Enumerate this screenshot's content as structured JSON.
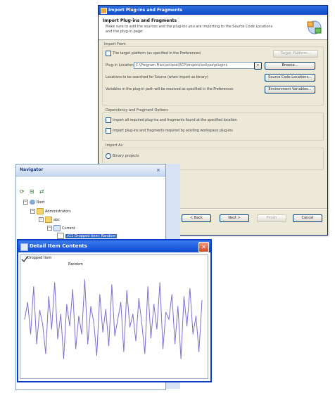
{
  "wizard": {
    "title": "Import Plug-ins and Fragments",
    "header_title": "Import Plug-ins and Fragments",
    "header_desc": "Make sure to add the sources and the plug-ins you are importing to the Source Code Locations and the plug-in page.",
    "import_from_label": "Import From",
    "checkbox_target_label": "The target platform (as specified in the Preferences)",
    "checkbox_target_btn": "Target Platform...",
    "plugin_location_label": "Plug-in Location:",
    "plugin_location_value": "C:\\Program Files\\eclipse\\RCP\\dropins\\eclipse\\plugins",
    "browse_btn": "Browse...",
    "source_locations_label": "Locations to be searched for Source (when import as binary)",
    "source_locations_btn": "Source Code Locations...",
    "env_label": "Variables in the plug-in path will be resolved as specified in the Preferences",
    "env_btn": "Environment Variables...",
    "dependency_label": "Dependency and Fragment Options",
    "opt1_label": "Import all required plug-ins and fragments found at the specified location",
    "opt2_label": "Import plug-ins and fragments required by existing workspace plug-ins",
    "import_as_label": "Import As",
    "binary_label": "Binary projects",
    "back_btn": "< Back",
    "next_btn": "Next >",
    "finish_btn": "Finish",
    "cancel_btn": "Cancel"
  },
  "navigator": {
    "title": "Navigator",
    "tree": [
      {
        "label": "Root",
        "depth": 0
      },
      {
        "label": "Administrators",
        "depth": 1
      },
      {
        "label": "abc",
        "depth": 2
      },
      {
        "label": "Current",
        "depth": 3
      },
      {
        "label": "v11 Dropped Item: Random",
        "depth": 4
      }
    ]
  },
  "detail": {
    "title": "Detail Item Contents",
    "checkbox_label": "Dropped Item",
    "series_label": "Random",
    "close_icon": "close-icon"
  },
  "chart_data": {
    "type": "line",
    "series": [
      {
        "name": "Random",
        "color": "#7b6fd0",
        "values": [
          55,
          72,
          40,
          88,
          30,
          64,
          50,
          20,
          78,
          45,
          92,
          35,
          60,
          15,
          70,
          48,
          85,
          25,
          58,
          40,
          95,
          30,
          68,
          52,
          18,
          80,
          42,
          65,
          28,
          90,
          38,
          55,
          72,
          22,
          84,
          47,
          60,
          33,
          76,
          50,
          20,
          88,
          36,
          70,
          45,
          92,
          25,
          62,
          55,
          80,
          30,
          68,
          15,
          78,
          48,
          86,
          40,
          58,
          22,
          74
        ]
      }
    ],
    "ylim": [
      0,
      100
    ]
  }
}
